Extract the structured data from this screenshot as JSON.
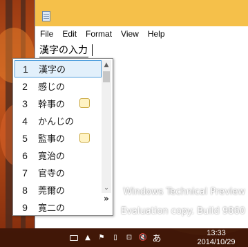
{
  "menubar": {
    "items": [
      "File",
      "Edit",
      "Format",
      "View",
      "Help"
    ]
  },
  "editor": {
    "composition_text": "漢字の入力"
  },
  "ime": {
    "candidates": [
      {
        "num": "1",
        "text": "漢字の",
        "selected": true,
        "has_note": false
      },
      {
        "num": "2",
        "text": "感じの",
        "selected": false,
        "has_note": false
      },
      {
        "num": "3",
        "text": "幹事の",
        "selected": false,
        "has_note": true
      },
      {
        "num": "4",
        "text": "かんじの",
        "selected": false,
        "has_note": false
      },
      {
        "num": "5",
        "text": "監事の",
        "selected": false,
        "has_note": true
      },
      {
        "num": "6",
        "text": "寛治の",
        "selected": false,
        "has_note": false
      },
      {
        "num": "7",
        "text": "官寺の",
        "selected": false,
        "has_note": false
      },
      {
        "num": "8",
        "text": "莞爾の",
        "selected": false,
        "has_note": false
      },
      {
        "num": "9",
        "text": "寛二の",
        "selected": false,
        "has_note": false
      }
    ],
    "scroll_up_glyph": "▲",
    "scroll_down_glyph": "⌄",
    "expand_glyph": "»"
  },
  "watermark": {
    "line1": "Windows Technical Preview",
    "line2": "Evaluation copy. Build 9860"
  },
  "taskbar": {
    "ime_mode_label": "あ",
    "time": "13:33",
    "date": "2014/10/29"
  },
  "colors": {
    "titlebar": "#f5c04a",
    "selection_border": "#4b9cdc",
    "selection_fill": "#e2f0fb",
    "taskbar": "#3c1608"
  }
}
